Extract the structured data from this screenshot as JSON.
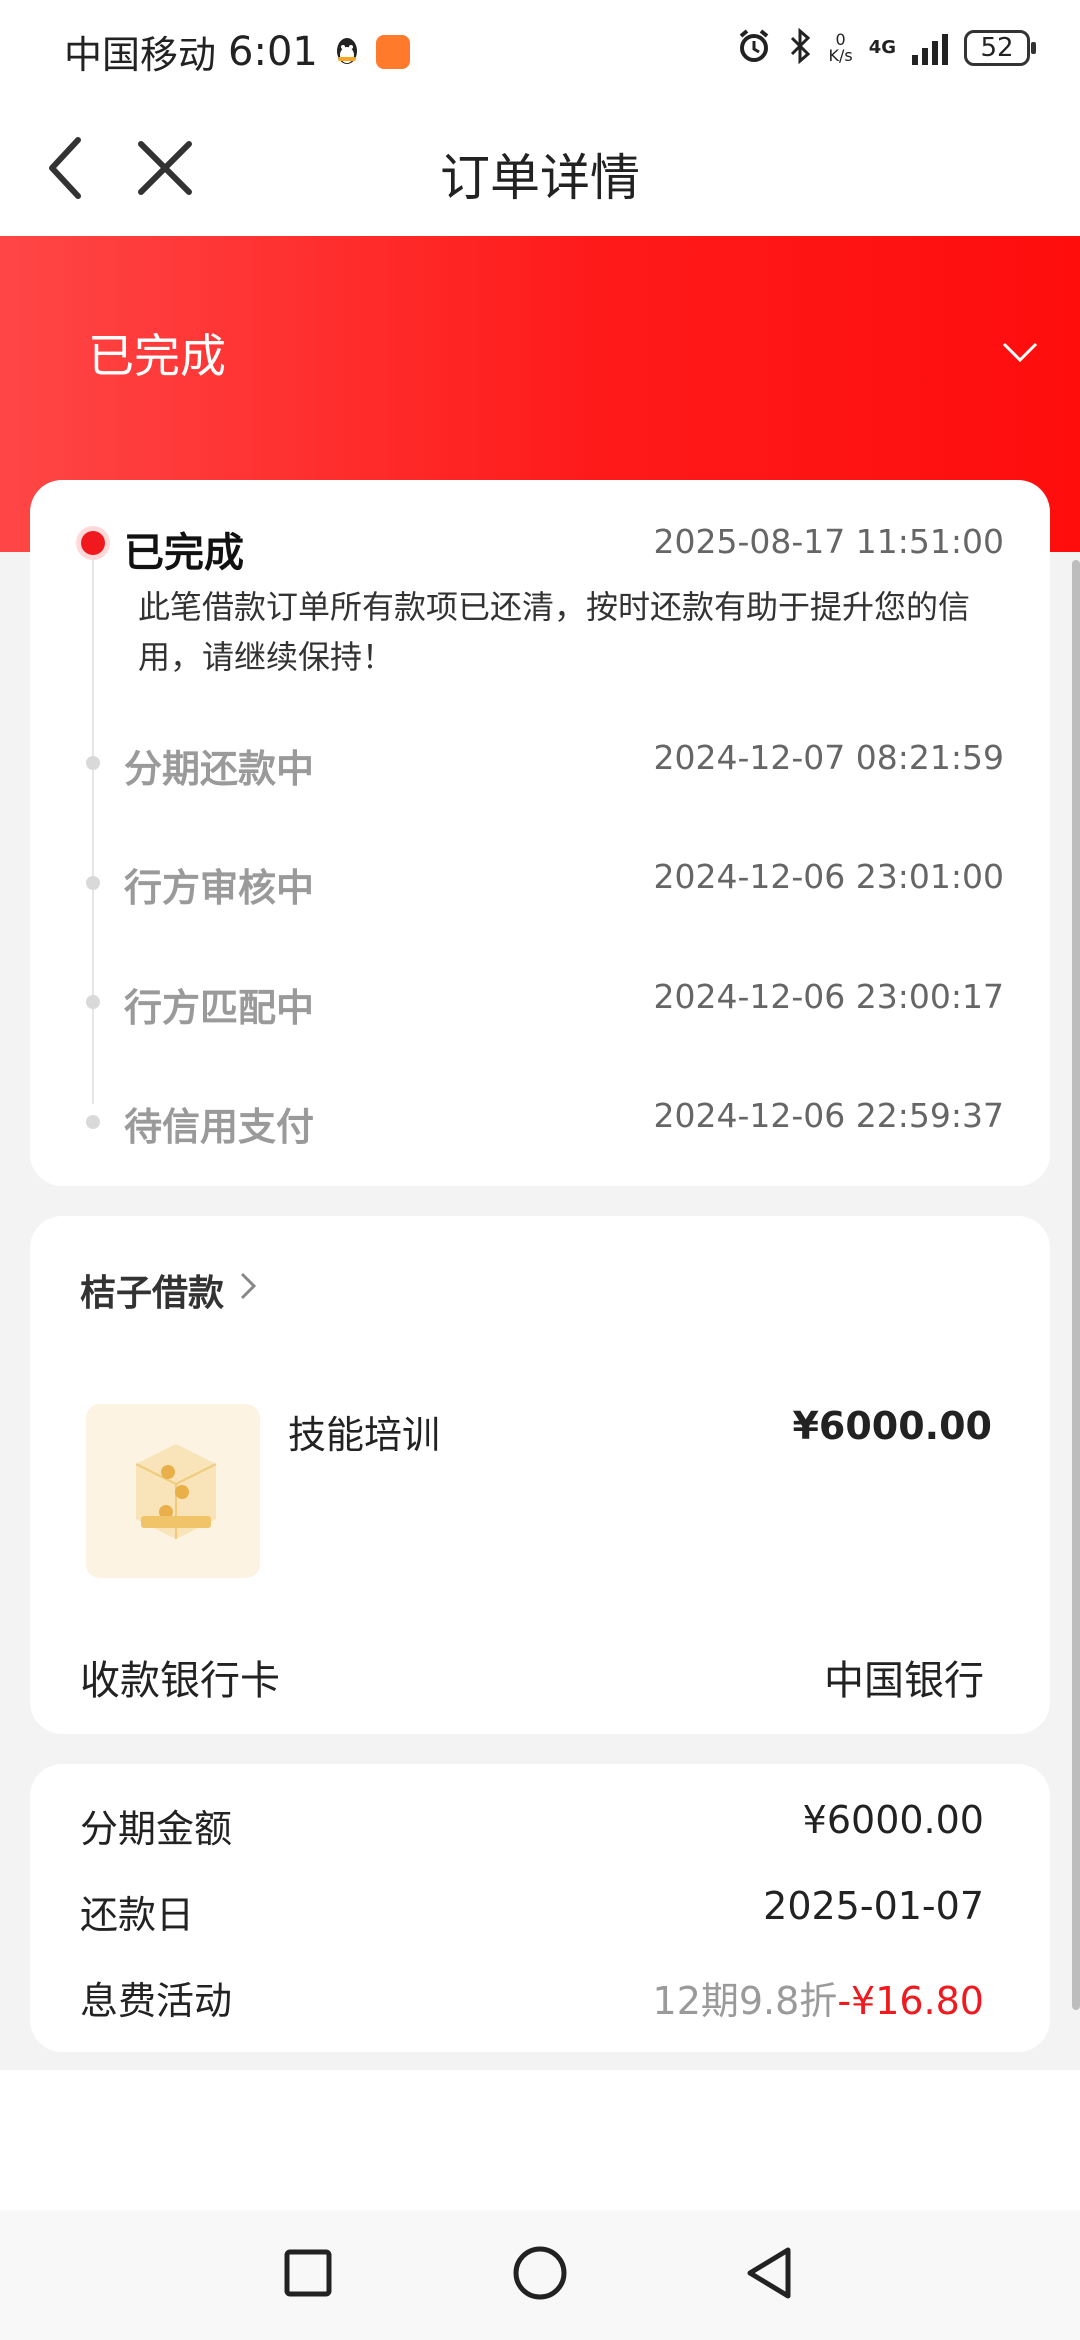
{
  "status_bar": {
    "carrier": "中国移动",
    "time": "6:01",
    "net_speed_top": "0",
    "net_speed_bottom": "K/s",
    "network_type": "4G",
    "battery": "52"
  },
  "nav": {
    "title": "订单详情"
  },
  "banner": {
    "status": "已完成"
  },
  "timeline": {
    "current": {
      "label": "已完成",
      "time": "2025-08-17 11:51:00",
      "desc": "此笔借款订单所有款项已还清，按时还款有助于提升您的信用，请继续保持！"
    },
    "steps": [
      {
        "label": "分期还款中",
        "time": "2024-12-07 08:21:59"
      },
      {
        "label": "行方审核中",
        "time": "2024-12-06 23:01:00"
      },
      {
        "label": "行方匹配中",
        "time": "2024-12-06 23:00:17"
      },
      {
        "label": "待信用支付",
        "time": "2024-12-06 22:59:37"
      }
    ]
  },
  "loan": {
    "provider": "桔子借款",
    "item_name": "技能培训",
    "amount": "¥6000.00",
    "bank_label": "收款银行卡",
    "bank_value": "中国银行"
  },
  "details": {
    "rows": [
      {
        "label": "分期金额",
        "value": "¥6000.00"
      },
      {
        "label": "还款日",
        "value": "2025-01-07"
      }
    ],
    "promo_label": "息费活动",
    "promo_text": "12期9.8折",
    "promo_discount": "-¥16.80"
  },
  "colors": {
    "accent_red": "#f0191e",
    "banner_red": "#ff1a1a"
  }
}
